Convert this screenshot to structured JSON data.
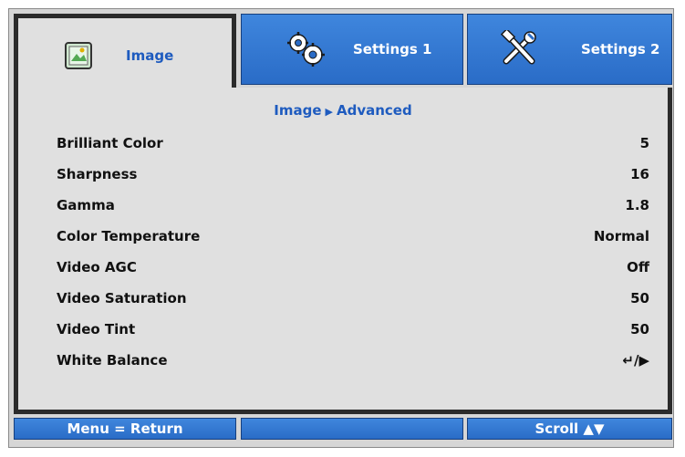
{
  "tabs": [
    {
      "label": "Image",
      "icon": "image-icon"
    },
    {
      "label": "Settings 1",
      "icon": "gears-icon"
    },
    {
      "label": "Settings 2",
      "icon": "tools-icon"
    }
  ],
  "breadcrumb": {
    "parent": "Image",
    "separator": "▶",
    "current": "Advanced"
  },
  "rows": [
    {
      "label": "Brilliant Color",
      "value": "5"
    },
    {
      "label": "Sharpness",
      "value": "16"
    },
    {
      "label": "Gamma",
      "value": "1.8"
    },
    {
      "label": "Color Temperature",
      "value": "Normal"
    },
    {
      "label": "Video AGC",
      "value": "Off"
    },
    {
      "label": "Video Saturation",
      "value": "50"
    },
    {
      "label": "Video Tint",
      "value": "50"
    },
    {
      "label": "White Balance",
      "value": "↵/▶"
    }
  ],
  "footer": {
    "left": "Menu = Return",
    "middle": "",
    "right": "Scroll ▲▼"
  },
  "colors": {
    "accent_blue": "#2a6cc7",
    "panel": "#e0e0e0",
    "label_blue": "#1e5bbf"
  }
}
